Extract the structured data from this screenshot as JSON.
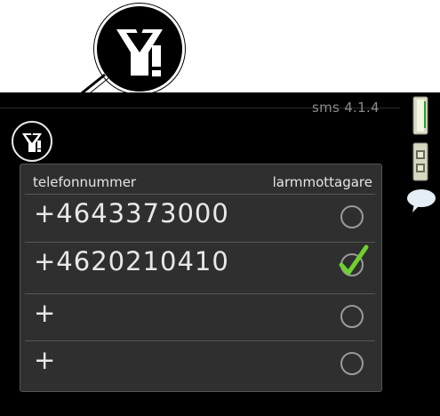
{
  "header": {
    "menu_code": "sms 4.1.4"
  },
  "icons": {
    "callout": "antenna-alert-icon",
    "scroll_top": "scroll-bar-icon",
    "scroll_mid": "scroll-thumb-icon",
    "help": "help-bubble-icon"
  },
  "table": {
    "col_phone": "telefonnummer",
    "col_alarm": "larmmottagare",
    "rows": [
      {
        "phone": "+4643373000",
        "alarm_recipient": false
      },
      {
        "phone": "+4620210410",
        "alarm_recipient": true
      },
      {
        "phone": "+",
        "alarm_recipient": false
      },
      {
        "phone": "+",
        "alarm_recipient": false
      }
    ]
  },
  "colors": {
    "check": "#6fcf2f",
    "panel": "#2e2f2e",
    "screen": "#000000"
  }
}
